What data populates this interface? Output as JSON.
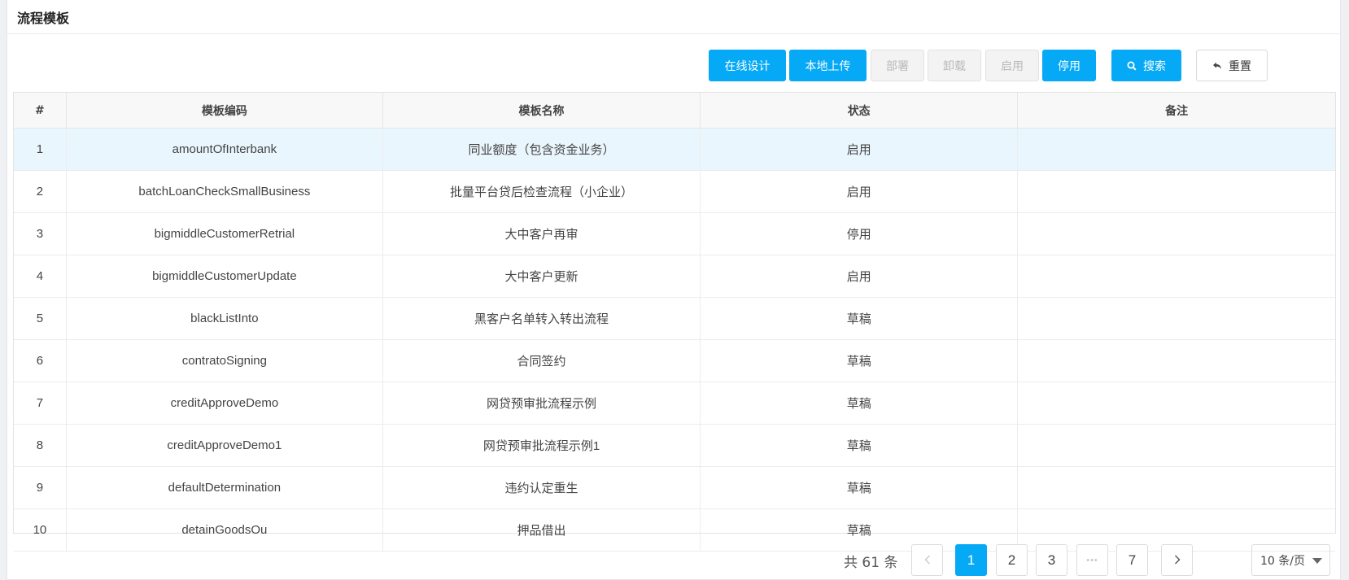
{
  "page": {
    "title": "流程模板"
  },
  "toolbar": {
    "online_design": "在线设计",
    "local_upload": "本地上传",
    "deploy": "部署",
    "uninstall": "卸载",
    "enable": "启用",
    "disable": "停用",
    "search": "搜索",
    "reset": "重置"
  },
  "table": {
    "headers": {
      "index": "#",
      "code": "模板编码",
      "name": "模板名称",
      "status": "状态",
      "remark": "备注"
    },
    "rows": [
      {
        "index": "1",
        "code": "amountOfInterbank",
        "name": "同业额度（包含资金业务）",
        "status": "启用",
        "remark": ""
      },
      {
        "index": "2",
        "code": "batchLoanCheckSmallBusiness",
        "name": "批量平台贷后检查流程（小企业）",
        "status": "启用",
        "remark": ""
      },
      {
        "index": "3",
        "code": "bigmiddleCustomerRetrial",
        "name": "大中客户再审",
        "status": "停用",
        "remark": ""
      },
      {
        "index": "4",
        "code": "bigmiddleCustomerUpdate",
        "name": "大中客户更新",
        "status": "启用",
        "remark": ""
      },
      {
        "index": "5",
        "code": "blackListInto",
        "name": "黑客户名单转入转出流程",
        "status": "草稿",
        "remark": ""
      },
      {
        "index": "6",
        "code": "contratoSigning",
        "name": "合同签约",
        "status": "草稿",
        "remark": ""
      },
      {
        "index": "7",
        "code": "creditApproveDemo",
        "name": "网贷预审批流程示例",
        "status": "草稿",
        "remark": ""
      },
      {
        "index": "8",
        "code": "creditApproveDemo1",
        "name": "网贷预审批流程示例1",
        "status": "草稿",
        "remark": ""
      },
      {
        "index": "9",
        "code": "defaultDetermination",
        "name": "违约认定重生",
        "status": "草稿",
        "remark": ""
      },
      {
        "index": "10",
        "code": "detainGoodsOu",
        "name": "押品借出",
        "status": "草稿",
        "remark": ""
      }
    ]
  },
  "pagination": {
    "total_text": "共 61 条",
    "pages": [
      "1",
      "2",
      "3",
      "7"
    ],
    "ellipsis": "•••",
    "current": "1",
    "page_size": "10 条/页"
  },
  "colors": {
    "primary": "#06a9f6",
    "highlight_row": "#eaf6fd"
  },
  "icons": {
    "search": "search-icon",
    "reset": "undo-arrow-icon",
    "prev": "chevron-left-icon",
    "next": "chevron-right-icon",
    "select": "caret-down-icon"
  }
}
